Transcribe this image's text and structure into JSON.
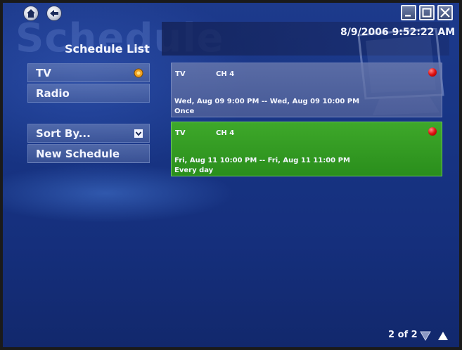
{
  "app": {
    "background_word": "Schedule",
    "page_title": "Schedule List",
    "clock": "8/9/2006 9:52:22 AM"
  },
  "nav": {
    "home_icon": "home-icon",
    "back_icon": "back-arrow-icon"
  },
  "window_controls": {
    "minimize_icon": "minimize-icon",
    "maximize_icon": "maximize-icon",
    "close_icon": "close-icon"
  },
  "menu": {
    "items": [
      {
        "label": "TV",
        "icon": "selected-indicator-icon"
      },
      {
        "label": "Radio"
      },
      {
        "label": "Sort By...",
        "icon": "dropdown-checkbox-icon"
      },
      {
        "label": "New Schedule"
      }
    ]
  },
  "schedules": [
    {
      "source": "TV",
      "channel": "CH 4",
      "when": "Wed, Aug 09 9:00 PM -- Wed, Aug 09 10:00 PM",
      "frequency": "Once",
      "status_icon": "record-icon"
    },
    {
      "source": "TV",
      "channel": "CH 4",
      "when": "Fri, Aug 11 10:00 PM -- Fri, Aug 11 11:00 PM",
      "frequency": "Every day",
      "status_icon": "record-icon"
    }
  ],
  "pager": {
    "text": "2 of 2"
  },
  "colors": {
    "background": "#183585",
    "selected_card": "#3ea82a",
    "record": "#e01010",
    "tv_indicator": "#f0a020"
  }
}
